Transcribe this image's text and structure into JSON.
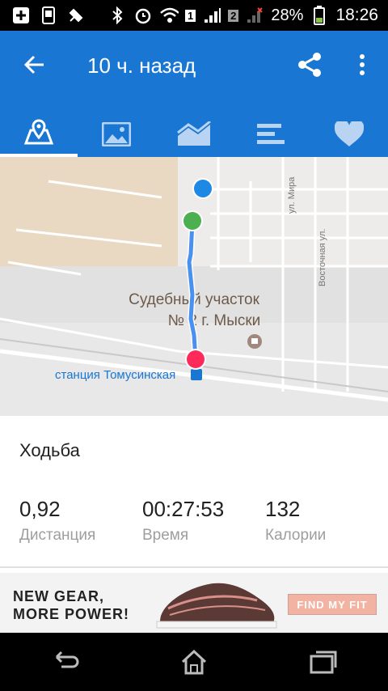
{
  "status_bar": {
    "battery_percent": "28%",
    "time": "18:26",
    "sim1": "1",
    "sim2": "2"
  },
  "app_bar": {
    "title": "10 ч. назад",
    "color": "#1976d2"
  },
  "tabs": [
    {
      "icon": "map-icon",
      "active": true
    },
    {
      "icon": "image-icon",
      "active": false
    },
    {
      "icon": "chart-icon",
      "active": false
    },
    {
      "icon": "bar-list-icon",
      "active": false
    },
    {
      "icon": "heart-icon",
      "active": false
    }
  ],
  "map": {
    "street_1": "ул. Мира",
    "street_2": "Восточная ул.",
    "place_label_line1": "Судебный участок",
    "place_label_line2": "№ 2 г. Мыски",
    "station_label": "станция Томусинская",
    "route_color": "#4a90f0",
    "start_marker_color": "#4caf50",
    "end_marker_color": "#ff2a5a",
    "current_marker_color": "#1e88e5"
  },
  "workout": {
    "activity": "Ходьба",
    "distance_value": "0,92",
    "distance_label": "Дистанция",
    "time_value": "00:27:53",
    "time_label": "Время",
    "calories_value": "132",
    "calories_label": "Калории"
  },
  "ad": {
    "line1": "NEW GEAR,",
    "line2": "MORE POWER!",
    "button": "FIND MY FIT"
  },
  "nav": {
    "back": "back-icon",
    "home": "home-icon",
    "recents": "recents-icon"
  }
}
